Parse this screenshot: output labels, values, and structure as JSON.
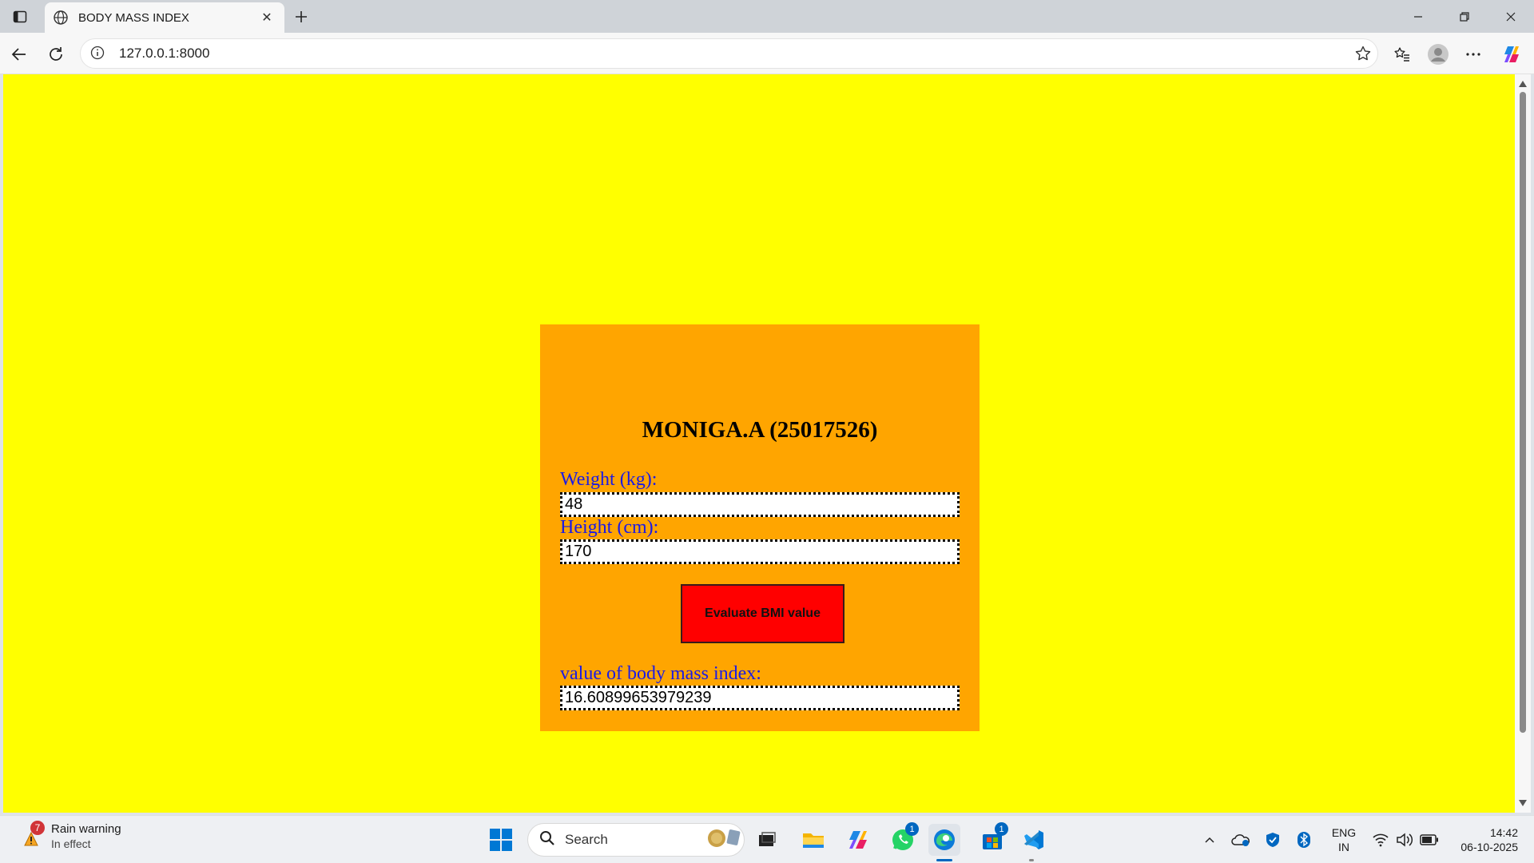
{
  "browser": {
    "tab_title": "BODY MASS INDEX",
    "url": "127.0.0.1:8000"
  },
  "page": {
    "heading": "MONIGA.A (25017526)",
    "weight_label": "Weight (kg):",
    "weight_value": "48",
    "height_label": "Height (cm):",
    "height_value": "170",
    "button_label": "Evaluate BMI value",
    "result_label": "value of body mass index:",
    "result_value": "16.60899653979239",
    "colors": {
      "background": "#ffff00",
      "card": "#ffa500",
      "button": "#ff0000",
      "label": "#1a1ae6"
    }
  },
  "taskbar": {
    "weather_title": "Rain warning",
    "weather_subtitle": "In effect",
    "weather_badge": "7",
    "search_placeholder": "Search",
    "whatsapp_badge": "1",
    "store_badge": "1",
    "lang_line1": "ENG",
    "lang_line2": "IN",
    "time": "14:42",
    "date": "06-10-2025"
  }
}
